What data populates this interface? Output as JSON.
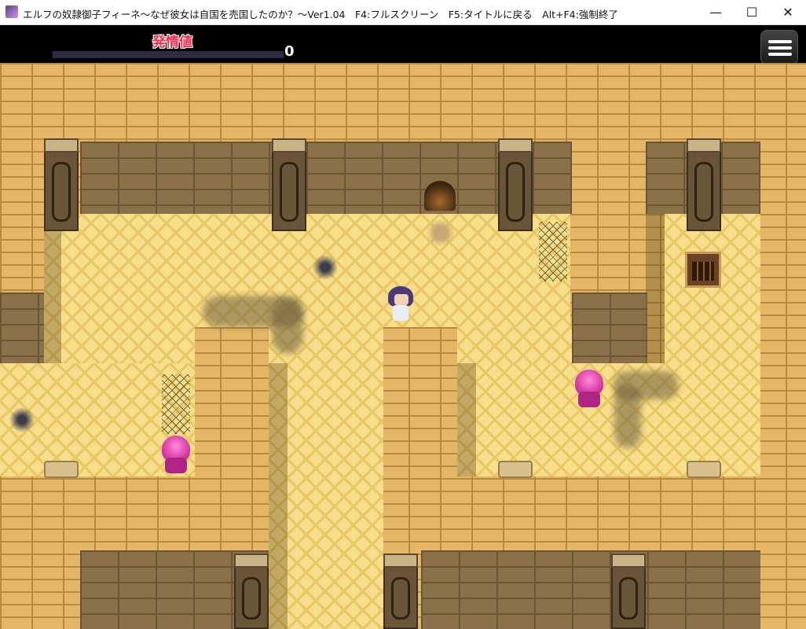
{
  "window": {
    "title": "エルフの奴隷御子フィーネ～なぜ彼女は自国を売国したのか？～Ver1.04　F4:フルスクリーン　F5:タイトルに戻る　Alt+F4:強制終了",
    "minimize_glyph": "—",
    "maximize_glyph": "☐",
    "close_glyph": "✕"
  },
  "hud": {
    "gauge_label": "発情値",
    "gauge_value": "0",
    "gauge_fraction": 0,
    "menu_icon": "hamburger-menu-icon"
  },
  "colors": {
    "gauge_label": "#ff2a4a",
    "floor": "#f7de8c",
    "wall_top": "#e3b766",
    "wall_face": "#8a7048",
    "enemy": "#d0309e",
    "player_hair": "#4a3a7a"
  },
  "map": {
    "entities": [
      {
        "name": "player-character",
        "kind": "player"
      },
      {
        "name": "tentacle-monster-left",
        "kind": "enemy"
      },
      {
        "name": "tentacle-monster-right",
        "kind": "enemy"
      },
      {
        "name": "bookshelf",
        "kind": "object"
      },
      {
        "name": "dirt-mound",
        "kind": "object"
      }
    ]
  }
}
